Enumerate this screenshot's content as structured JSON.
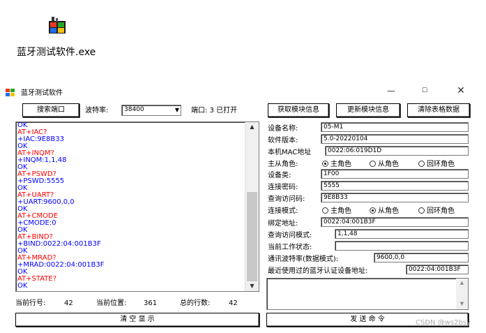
{
  "desktop": {
    "file_label": "蓝牙测试软件.exe"
  },
  "window": {
    "title": "蓝牙测试软件",
    "controls": {
      "minimize": "—",
      "maximize": "☐",
      "close": "✕"
    }
  },
  "toolbar": {
    "search_port_label": "搜索端口",
    "baud_label": "波特率:",
    "baud_value": "38400",
    "port_status": "端口: 3 已打开",
    "get_info_label": "获取模块信息",
    "update_info_label": "更新模块信息",
    "clear_table_label": "清除表格数据"
  },
  "log": {
    "lines": [
      {
        "text": "OK",
        "color": "#0000ff"
      },
      {
        "text": "AT+IAC?",
        "color": "#ff0000"
      },
      {
        "text": "+IAC:9E8B33",
        "color": "#0000ff"
      },
      {
        "text": "OK",
        "color": "#0000ff"
      },
      {
        "text": "AT+INQM?",
        "color": "#ff0000"
      },
      {
        "text": "+INQM:1,1,48",
        "color": "#0000ff"
      },
      {
        "text": "OK",
        "color": "#0000ff"
      },
      {
        "text": "AT+PSWD?",
        "color": "#ff0000"
      },
      {
        "text": "+PSWD:5555",
        "color": "#0000ff"
      },
      {
        "text": "OK",
        "color": "#0000ff"
      },
      {
        "text": "AT+UART?",
        "color": "#ff0000"
      },
      {
        "text": "+UART:9600,0,0",
        "color": "#0000ff"
      },
      {
        "text": "OK",
        "color": "#0000ff"
      },
      {
        "text": "AT+CMODE",
        "color": "#ff0000"
      },
      {
        "text": "+CMODE:0",
        "color": "#0000ff"
      },
      {
        "text": "OK",
        "color": "#0000ff"
      },
      {
        "text": "AT+BIND?",
        "color": "#ff0000"
      },
      {
        "text": "+BIND:0022:04:001B3F",
        "color": "#0000ff"
      },
      {
        "text": "OK",
        "color": "#0000ff"
      },
      {
        "text": "AT+MRAD?",
        "color": "#ff0000"
      },
      {
        "text": "+MRAD:0022:04:001B3F",
        "color": "#0000ff"
      },
      {
        "text": "OK",
        "color": "#0000ff"
      },
      {
        "text": "AT+STATE?",
        "color": "#ff0000"
      },
      {
        "text": "OK",
        "color": "#0000ff"
      }
    ]
  },
  "status": {
    "current_line_label": "当前行号:",
    "current_line_value": "42",
    "current_pos_label": "当前位置:",
    "current_pos_value": "361",
    "total_lines_label": "总的行数:",
    "total_lines_value": "42"
  },
  "fields": {
    "device_name_label": "设备名称:",
    "device_name_value": "05-M1",
    "version_label": "软件版本:",
    "version_value": "5.0-20220104",
    "mac_label": "本机MAC地址",
    "mac_value": "0022:06:019D1D",
    "role_label": "主从角色:",
    "role_options": [
      "主角色",
      "从角色",
      "回环角色"
    ],
    "device_class_label": "设备类:",
    "device_class_value": "1F00",
    "pin_label": "连接密码:",
    "pin_value": "5555",
    "iac_label": "查询访问码:",
    "iac_value": "9E8B33",
    "conn_mode_label": "连接模式:",
    "conn_mode_options": [
      "主角色",
      "从角色",
      "回环角色"
    ],
    "bind_label": "绑定地址:",
    "bind_value": "0022:04:001B3F",
    "inq_mode_label": "查询访问模式:",
    "inq_mode_value": "1,1,48",
    "state_label": "当前工作状态:",
    "state_value": "",
    "uart_label": "通讯波特率(数据模式):",
    "uart_value": "9600,0,0",
    "recent_label": "最近使用过的蓝牙认证设备地址:",
    "recent_value": "0022:04:001B3F"
  },
  "bottom": {
    "clear_display_label": "清 空 显 示",
    "send_label": "发 送 命 令"
  },
  "watermark": "CSDN @ws2bsy"
}
